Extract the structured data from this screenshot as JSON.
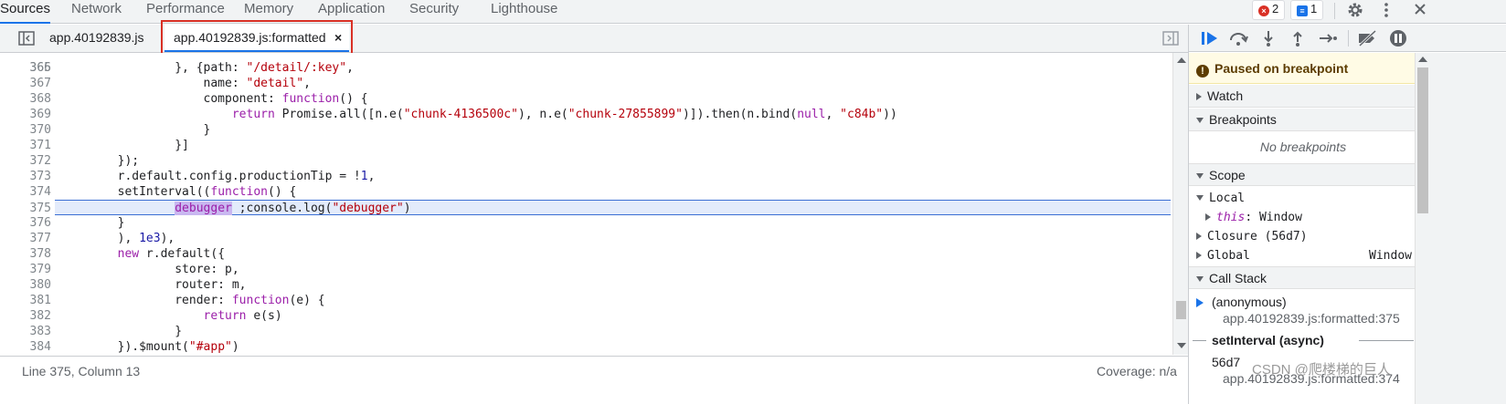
{
  "top_tabs": [
    "Sources",
    "Network",
    "Performance",
    "Memory",
    "Application",
    "Security",
    "Lighthouse"
  ],
  "badges": {
    "errors": "2",
    "messages": "1"
  },
  "editor_tabs": {
    "tab1": "app.40192839.js",
    "tab2": "app.40192839.js:formatted",
    "close": "×"
  },
  "code_lines": [
    {
      "n": "366",
      "text": "        path: \"/detail/:key\","
    },
    {
      "n": "367",
      "text": "        name: \"detail\","
    },
    {
      "n": "368",
      "text": "        component: function() {"
    },
    {
      "n": "369",
      "text": "            return Promise.all([n.e(\"chunk-4136500c\"), n.e(\"chunk-27855899\")]).then(n.bind(null, \"c84b\"))"
    },
    {
      "n": "370",
      "text": "        }"
    },
    {
      "n": "371",
      "text": "    }]"
    },
    {
      "n": "372",
      "text": "});"
    },
    {
      "n": "373",
      "text": "r.default.config.productionTip = !1,"
    },
    {
      "n": "374",
      "text": "setInterval((function() {"
    },
    {
      "n": "375",
      "text": "    debugger ;console.log(\"debugger\")"
    },
    {
      "n": "376",
      "text": "}"
    },
    {
      "n": "377",
      "text": "), 1e3),"
    },
    {
      "n": "378",
      "text": "new r.default({"
    },
    {
      "n": "379",
      "text": "    store: p,"
    },
    {
      "n": "380",
      "text": "    router: m,"
    },
    {
      "n": "381",
      "text": "    render: function(e) {"
    },
    {
      "n": "382",
      "text": "        return e(s)"
    },
    {
      "n": "383",
      "text": "    }"
    },
    {
      "n": "384",
      "text": "}).$mount(\"#app\")"
    }
  ],
  "status": {
    "position": "Line 375, Column 13",
    "coverage": "Coverage: n/a"
  },
  "debugger": {
    "paused": "Paused on breakpoint",
    "watch": "Watch",
    "breakpoints": "Breakpoints",
    "no_breakpoints": "No breakpoints",
    "scope": "Scope",
    "local": "Local",
    "this_key": "this",
    "this_val": ": Window",
    "closure": "Closure (56d7)",
    "global": "Global",
    "global_val": "Window",
    "call_stack": "Call Stack",
    "frame1_name": "(anonymous)",
    "frame1_loc": "app.40192839.js:formatted:375",
    "async_label": "setInterval (async)",
    "frame2_name": "56d7",
    "frame2_loc": "app.40192839.js:formatted:374"
  },
  "watermark": "CSDN @爬楼梯的巨人",
  "colors": {
    "accent": "#1a73e8",
    "highlight_box": "#d93025",
    "exec_line": "#e3ebfb"
  }
}
